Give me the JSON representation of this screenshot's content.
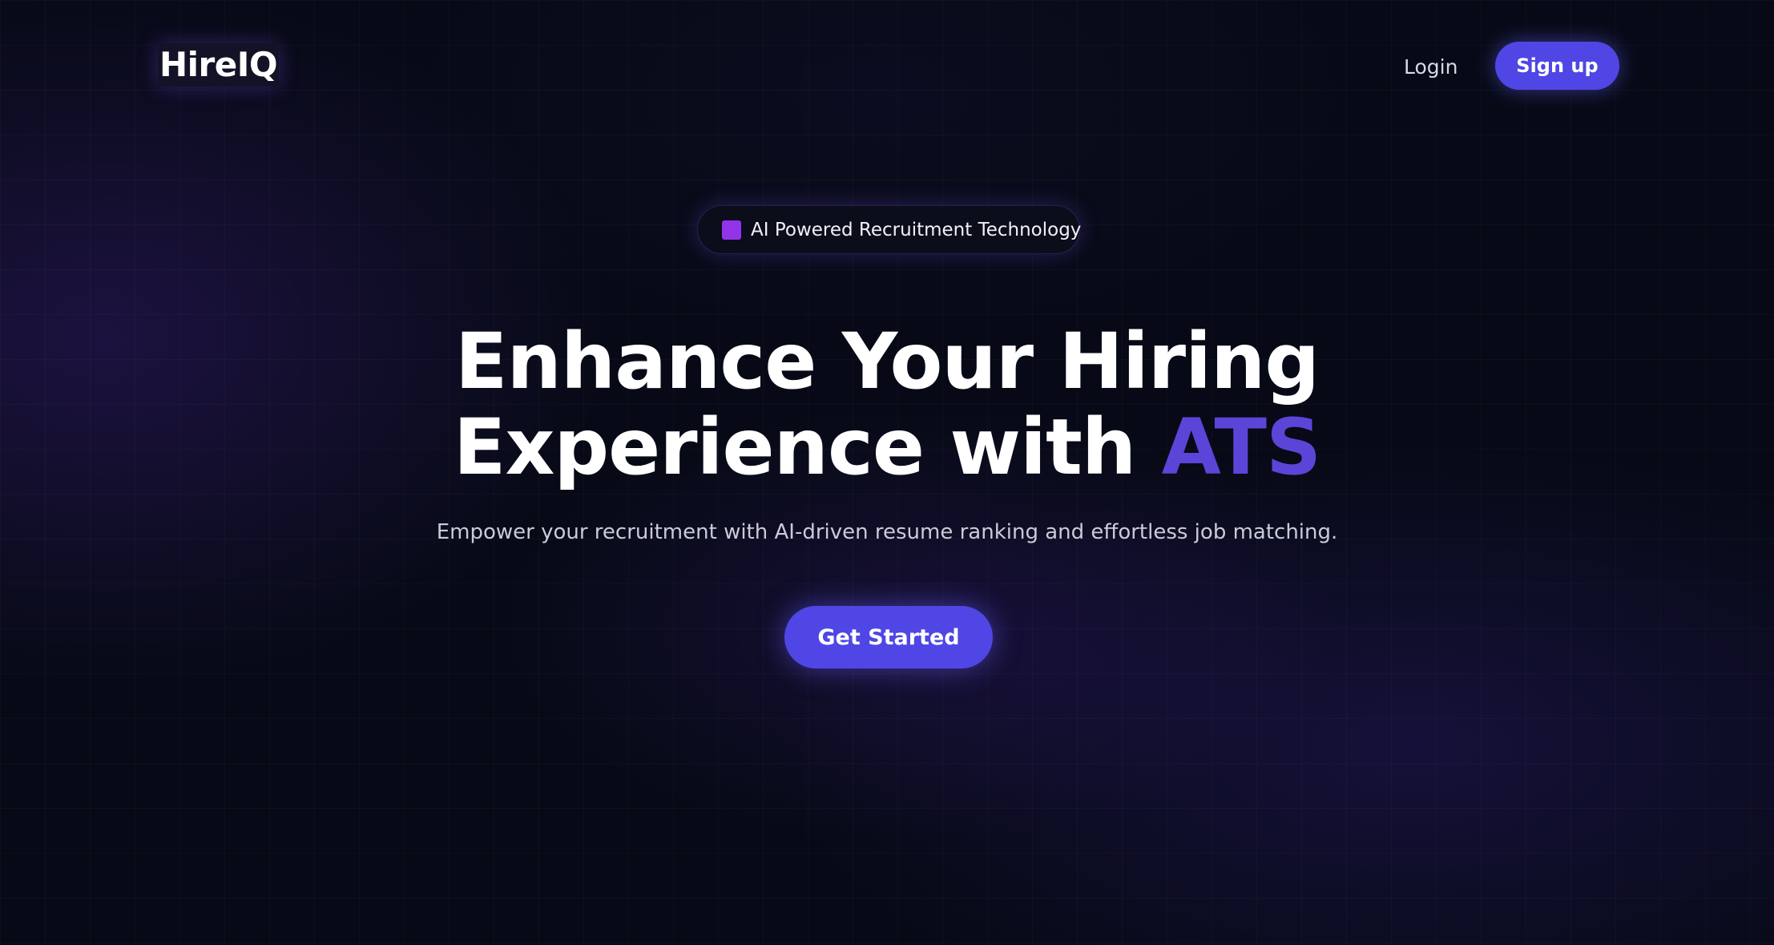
{
  "nav": {
    "logo": "HireIQ",
    "login_label": "Login",
    "signup_label": "Sign up"
  },
  "hero": {
    "badge_icon": "purple-square-icon",
    "badge_text": "AI Powered Recruitment Technology",
    "headline_line1": "Enhance Your Hiring",
    "headline_line2_prefix": "Experience with ",
    "headline_accent": "ATS",
    "subtitle": "Empower your recruitment with AI-driven resume ranking and effortless job matching.",
    "cta_label": "Get Started"
  },
  "colors": {
    "background": "#070a16",
    "primary": "#4f46e5",
    "accent_text": "#5b45d8",
    "badge_square": "#9333ea"
  }
}
